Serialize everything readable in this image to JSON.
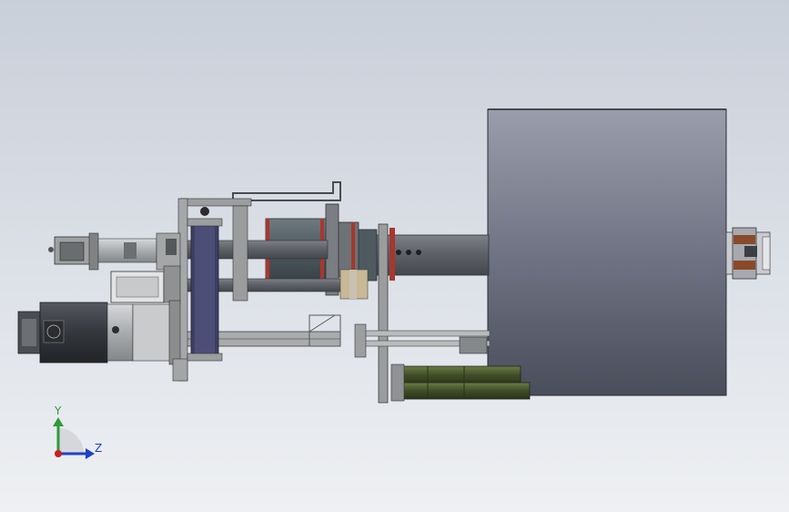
{
  "triad": {
    "y_label": "Y",
    "z_label": "Z",
    "y_color": "#2e9a3a",
    "z_color": "#2040c8",
    "x_color": "#c82020"
  },
  "colors": {
    "background_top": "#c9cfd9",
    "background_bottom": "#eef0f3",
    "drum": "#6f7383",
    "frame": "#8a8c8c",
    "motor": "#3c3f44",
    "green_rollers": "#4a5a30",
    "shaft": "#5a5d63"
  }
}
